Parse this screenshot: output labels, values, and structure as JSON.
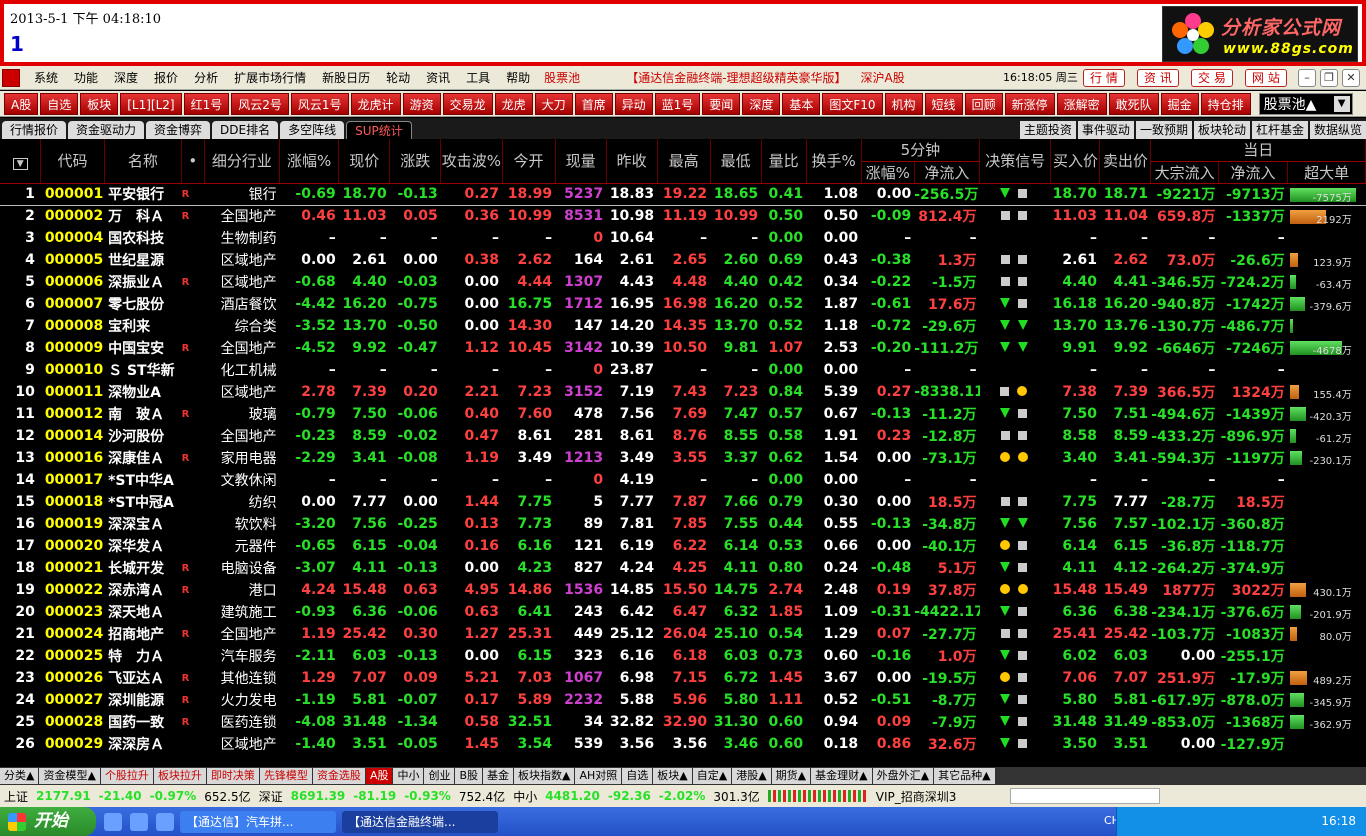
{
  "top": {
    "datetime": "2013-5-1 下午 04:18:10",
    "big_number": "1",
    "logo_line1": "分析家公式网",
    "logo_line2": "www.88gs.com"
  },
  "menu": {
    "items": [
      "系统",
      "功能",
      "深度",
      "报价",
      "分析",
      "扩展市场行情",
      "新股日历",
      "轮动",
      "资讯",
      "工具",
      "帮助"
    ],
    "pool": "股票池",
    "title": "【通达信金融终端-理想超级精英豪华版】",
    "market": "深沪A股",
    "clock": "16:18:05 周三",
    "quick": [
      "行 情",
      "资 讯",
      "交 易",
      "网 站"
    ]
  },
  "toolbar": {
    "buttons": [
      "A股",
      "自选",
      "板块",
      "[L1][L2]",
      "红1号",
      "风云2号",
      "风云1号",
      "龙虎计",
      "游资",
      "交易龙",
      "龙虎",
      "大刀",
      "首席",
      "异动",
      "蓝1号",
      "要闻",
      "深度",
      "基本",
      "图文F10",
      "机构",
      "短线",
      "回顾",
      "新涨停",
      "涨解密",
      "敢死队",
      "掘金",
      "持仓排"
    ],
    "select": "股票池▲"
  },
  "tabs": {
    "left": [
      "行情报价",
      "资金驱动力",
      "资金博弈",
      "DDE排名",
      "多空阵线",
      "SUP统计"
    ],
    "active": 5,
    "right": [
      "主题投资",
      "事件驱动",
      "一致预期",
      "板块轮动",
      "杠杆基金",
      "数据纵览"
    ]
  },
  "headers": {
    "five_min": "5分钟",
    "day": "当日",
    "cols": [
      "代码",
      "名称",
      "•",
      "细分行业",
      "涨幅%",
      "现价",
      "涨跌",
      "攻击波%",
      "今开",
      "现量",
      "昨收",
      "最高",
      "最低",
      "量比",
      "换手%",
      "涨幅%",
      "净流入",
      "决策信号",
      "买入价",
      "卖出价",
      "大宗流入",
      "净流入",
      "超大单"
    ]
  },
  "rows": [
    {
      "i": "1",
      "code": "000001",
      "name": "平安银行",
      "r": "R",
      "ind": "银行",
      "chg": "-0.69",
      "price": "18.70",
      "d": "-0.13",
      "atk": "0.27",
      "open": "18.99",
      "vol": "5237",
      "prev": "18.83",
      "hi": "19.22",
      "lo": "18.65",
      "lb": "0.41",
      "turn": "1.08",
      "m5": "0.00",
      "m5n": "-256.5万",
      "sig": [
        "tri",
        "sq"
      ],
      "buy": "18.70",
      "sell": "18.71",
      "big": "-9221万",
      "net": "-9713万",
      "sup": "-7575万",
      "supv": -7575
    },
    {
      "i": "2",
      "code": "000002",
      "name": "万　科Ａ",
      "r": "R",
      "ind": "全国地产",
      "chg": "0.46",
      "price": "11.03",
      "d": "0.05",
      "atk": "0.36",
      "open": "10.99",
      "vol": "8531",
      "prev": "10.98",
      "hi": "11.19",
      "lo": "10.99",
      "lb": "0.50",
      "turn": "0.50",
      "m5": "-0.09",
      "m5n": "812.4万",
      "sig": [
        "sq",
        "sq"
      ],
      "buy": "11.03",
      "sell": "11.04",
      "big": "659.8万",
      "net": "-1337万",
      "sup": "2192万",
      "supv": 2192
    },
    {
      "i": "3",
      "code": "000004",
      "name": "国农科技",
      "r": "",
      "ind": "生物制药",
      "chg": "–",
      "price": "–",
      "d": "–",
      "atk": "–",
      "open": "–",
      "vol": "0",
      "prev": "10.64",
      "hi": "–",
      "lo": "–",
      "lb": "0.00",
      "turn": "0.00",
      "m5": "–",
      "m5n": "–",
      "sig": [],
      "buy": "–",
      "sell": "–",
      "big": "–",
      "net": "–",
      "sup": "",
      "supv": 0
    },
    {
      "i": "4",
      "code": "000005",
      "name": "世纪星源",
      "r": "",
      "ind": "区域地产",
      "chg": "0.00",
      "price": "2.61",
      "d": "0.00",
      "atk": "0.38",
      "open": "2.62",
      "vol": "164",
      "prev": "2.61",
      "hi": "2.65",
      "lo": "2.60",
      "lb": "0.69",
      "turn": "0.43",
      "m5": "-0.38",
      "m5n": "1.3万",
      "sig": [
        "sq",
        "sq"
      ],
      "buy": "2.61",
      "sell": "2.62",
      "big": "73.0万",
      "net": "-26.6万",
      "sup": "123.9万",
      "supv": 124
    },
    {
      "i": "5",
      "code": "000006",
      "name": "深振业Ａ",
      "r": "R",
      "ind": "区域地产",
      "chg": "-0.68",
      "price": "4.40",
      "d": "-0.03",
      "atk": "0.00",
      "open": "4.44",
      "vol": "1307",
      "prev": "4.43",
      "hi": "4.48",
      "lo": "4.40",
      "lb": "0.42",
      "turn": "0.34",
      "m5": "-0.22",
      "m5n": "-1.5万",
      "sig": [
        "sq",
        "sq"
      ],
      "buy": "4.40",
      "sell": "4.41",
      "big": "-346.5万",
      "net": "-724.2万",
      "sup": "-63.4万",
      "supv": -63
    },
    {
      "i": "6",
      "code": "000007",
      "name": "零七股份",
      "r": "",
      "ind": "酒店餐饮",
      "chg": "-4.42",
      "price": "16.20",
      "d": "-0.75",
      "atk": "0.00",
      "open": "16.75",
      "vol": "1712",
      "prev": "16.95",
      "hi": "16.98",
      "lo": "16.20",
      "lb": "0.52",
      "turn": "1.87",
      "m5": "-0.61",
      "m5n": "17.6万",
      "sig": [
        "tri",
        "sq"
      ],
      "buy": "16.18",
      "sell": "16.20",
      "big": "-940.8万",
      "net": "-1742万",
      "sup": "-379.6万",
      "supv": -380
    },
    {
      "i": "7",
      "code": "000008",
      "name": "宝利来",
      "r": "",
      "ind": "综合类",
      "chg": "-3.52",
      "price": "13.70",
      "d": "-0.50",
      "atk": "0.00",
      "open": "14.30",
      "vol": "147",
      "prev": "14.20",
      "hi": "14.35",
      "lo": "13.70",
      "lb": "0.52",
      "turn": "1.18",
      "m5": "-0.72",
      "m5n": "-29.6万",
      "sig": [
        "tri",
        "tri"
      ],
      "buy": "13.70",
      "sell": "13.76",
      "big": "-130.7万",
      "net": "-486.7万",
      "sup": "",
      "supv": -2
    },
    {
      "i": "8",
      "code": "000009",
      "name": "中国宝安",
      "r": "R",
      "ind": "全国地产",
      "chg": "-4.52",
      "price": "9.92",
      "d": "-0.47",
      "atk": "1.12",
      "open": "10.45",
      "vol": "3142",
      "prev": "10.39",
      "hi": "10.50",
      "lo": "9.81",
      "lb": "1.07",
      "turn": "2.53",
      "m5": "-0.20",
      "m5n": "-111.2万",
      "sig": [
        "tri",
        "tri"
      ],
      "buy": "9.91",
      "sell": "9.92",
      "big": "-6646万",
      "net": "-7246万",
      "sup": "-4678万",
      "supv": -4678
    },
    {
      "i": "9",
      "code": "000010",
      "name": "Ｓ ST华新",
      "r": "",
      "ind": "化工机械",
      "chg": "–",
      "price": "–",
      "d": "–",
      "atk": "–",
      "open": "–",
      "vol": "0",
      "prev": "23.87",
      "hi": "–",
      "lo": "–",
      "lb": "0.00",
      "turn": "0.00",
      "m5": "–",
      "m5n": "–",
      "sig": [],
      "buy": "–",
      "sell": "–",
      "big": "–",
      "net": "–",
      "sup": "",
      "supv": 0
    },
    {
      "i": "10",
      "code": "000011",
      "name": "深物业A",
      "r": "",
      "ind": "区域地产",
      "chg": "2.78",
      "price": "7.39",
      "d": "0.20",
      "atk": "2.21",
      "open": "7.23",
      "vol": "3152",
      "prev": "7.19",
      "hi": "7.43",
      "lo": "7.23",
      "lb": "0.84",
      "turn": "5.39",
      "m5": "0.27",
      "m5n": "-8338.11",
      "sig": [
        "sq",
        "dot"
      ],
      "buy": "7.38",
      "sell": "7.39",
      "big": "366.5万",
      "net": "1324万",
      "sup": "155.4万",
      "supv": 155
    },
    {
      "i": "11",
      "code": "000012",
      "name": "南　玻Ａ",
      "r": "R",
      "ind": "玻璃",
      "chg": "-0.79",
      "price": "7.50",
      "d": "-0.06",
      "atk": "0.40",
      "open": "7.60",
      "vol": "478",
      "prev": "7.56",
      "hi": "7.69",
      "lo": "7.47",
      "lb": "0.57",
      "turn": "0.67",
      "m5": "-0.13",
      "m5n": "-11.2万",
      "sig": [
        "tri",
        "sq"
      ],
      "buy": "7.50",
      "sell": "7.51",
      "big": "-494.6万",
      "net": "-1439万",
      "sup": "-420.3万",
      "supv": -420
    },
    {
      "i": "12",
      "code": "000014",
      "name": "沙河股份",
      "r": "",
      "ind": "全国地产",
      "chg": "-0.23",
      "price": "8.59",
      "d": "-0.02",
      "atk": "0.47",
      "open": "8.61",
      "vol": "281",
      "prev": "8.61",
      "hi": "8.76",
      "lo": "8.55",
      "lb": "0.58",
      "turn": "1.91",
      "m5": "0.23",
      "m5n": "-12.8万",
      "sig": [
        "sq",
        "sq"
      ],
      "buy": "8.58",
      "sell": "8.59",
      "big": "-433.2万",
      "net": "-896.9万",
      "sup": "-61.2万",
      "supv": -61
    },
    {
      "i": "13",
      "code": "000016",
      "name": "深康佳Ａ",
      "r": "R",
      "ind": "家用电器",
      "chg": "-2.29",
      "price": "3.41",
      "d": "-0.08",
      "atk": "1.19",
      "open": "3.49",
      "vol": "1213",
      "prev": "3.49",
      "hi": "3.55",
      "lo": "3.37",
      "lb": "0.62",
      "turn": "1.54",
      "m5": "0.00",
      "m5n": "-73.1万",
      "sig": [
        "dot",
        "dot"
      ],
      "buy": "3.40",
      "sell": "3.41",
      "big": "-594.3万",
      "net": "-1197万",
      "sup": "-230.1万",
      "supv": -230
    },
    {
      "i": "14",
      "code": "000017",
      "name": "*ST中华A",
      "r": "",
      "ind": "文教休闲",
      "chg": "–",
      "price": "–",
      "d": "–",
      "atk": "–",
      "open": "–",
      "vol": "0",
      "prev": "4.19",
      "hi": "–",
      "lo": "–",
      "lb": "0.00",
      "turn": "0.00",
      "m5": "–",
      "m5n": "–",
      "sig": [],
      "buy": "–",
      "sell": "–",
      "big": "–",
      "net": "–",
      "sup": "",
      "supv": 0
    },
    {
      "i": "15",
      "code": "000018",
      "name": "*ST中冠A",
      "r": "",
      "ind": "纺织",
      "chg": "0.00",
      "price": "7.77",
      "d": "0.00",
      "atk": "1.44",
      "open": "7.75",
      "vol": "5",
      "prev": "7.77",
      "hi": "7.87",
      "lo": "7.66",
      "lb": "0.79",
      "turn": "0.30",
      "m5": "0.00",
      "m5n": "18.5万",
      "sig": [
        "sq",
        "sq"
      ],
      "buy": "7.75",
      "sell": "7.77",
      "big": "-28.7万",
      "net": "18.5万",
      "sup": "",
      "supv": 0
    },
    {
      "i": "16",
      "code": "000019",
      "name": "深深宝Ａ",
      "r": "",
      "ind": "软饮料",
      "chg": "-3.20",
      "price": "7.56",
      "d": "-0.25",
      "atk": "0.13",
      "open": "7.73",
      "vol": "89",
      "prev": "7.81",
      "hi": "7.85",
      "lo": "7.55",
      "lb": "0.44",
      "turn": "0.55",
      "m5": "-0.13",
      "m5n": "-34.8万",
      "sig": [
        "tri",
        "tri"
      ],
      "buy": "7.56",
      "sell": "7.57",
      "big": "-102.1万",
      "net": "-360.8万",
      "sup": "",
      "supv": 0
    },
    {
      "i": "17",
      "code": "000020",
      "name": "深华发Ａ",
      "r": "",
      "ind": "元器件",
      "chg": "-0.65",
      "price": "6.15",
      "d": "-0.04",
      "atk": "0.16",
      "open": "6.16",
      "vol": "121",
      "prev": "6.19",
      "hi": "6.22",
      "lo": "6.14",
      "lb": "0.53",
      "turn": "0.66",
      "m5": "0.00",
      "m5n": "-40.1万",
      "sig": [
        "dot",
        "sq"
      ],
      "buy": "6.14",
      "sell": "6.15",
      "big": "-36.8万",
      "net": "-118.7万",
      "sup": "",
      "supv": 0
    },
    {
      "i": "18",
      "code": "000021",
      "name": "长城开发",
      "r": "R",
      "ind": "电脑设备",
      "chg": "-3.07",
      "price": "4.11",
      "d": "-0.13",
      "atk": "0.00",
      "open": "4.23",
      "vol": "827",
      "prev": "4.24",
      "hi": "4.25",
      "lo": "4.11",
      "lb": "0.80",
      "turn": "0.24",
      "m5": "-0.48",
      "m5n": "5.1万",
      "sig": [
        "tri",
        "sq"
      ],
      "buy": "4.11",
      "sell": "4.12",
      "big": "-264.2万",
      "net": "-374.9万",
      "sup": "",
      "supv": 0
    },
    {
      "i": "19",
      "code": "000022",
      "name": "深赤湾Ａ",
      "r": "R",
      "ind": "港口",
      "chg": "4.24",
      "price": "15.48",
      "d": "0.63",
      "atk": "4.95",
      "open": "14.86",
      "vol": "1536",
      "prev": "14.85",
      "hi": "15.50",
      "lo": "14.75",
      "lb": "2.74",
      "turn": "2.48",
      "m5": "0.19",
      "m5n": "37.8万",
      "sig": [
        "dot",
        "dot"
      ],
      "buy": "15.48",
      "sell": "15.49",
      "big": "1877万",
      "net": "3022万",
      "sup": "430.1万",
      "supv": 430
    },
    {
      "i": "20",
      "code": "000023",
      "name": "深天地Ａ",
      "r": "",
      "ind": "建筑施工",
      "chg": "-0.93",
      "price": "6.36",
      "d": "-0.06",
      "atk": "0.63",
      "open": "6.41",
      "vol": "243",
      "prev": "6.42",
      "hi": "6.47",
      "lo": "6.32",
      "lb": "1.85",
      "turn": "1.09",
      "m5": "-0.31",
      "m5n": "-4422.17",
      "sig": [
        "tri",
        "sq"
      ],
      "buy": "6.36",
      "sell": "6.38",
      "big": "-234.1万",
      "net": "-376.6万",
      "sup": "-201.9万",
      "supv": -202
    },
    {
      "i": "21",
      "code": "000024",
      "name": "招商地产",
      "r": "R",
      "ind": "全国地产",
      "chg": "1.19",
      "price": "25.42",
      "d": "0.30",
      "atk": "1.27",
      "open": "25.31",
      "vol": "449",
      "prev": "25.12",
      "hi": "26.04",
      "lo": "25.10",
      "lb": "0.54",
      "turn": "1.29",
      "m5": "0.07",
      "m5n": "-27.7万",
      "sig": [
        "sq",
        "sq"
      ],
      "buy": "25.41",
      "sell": "25.42",
      "big": "-103.7万",
      "net": "-1083万",
      "sup": "80.0万",
      "supv": 80
    },
    {
      "i": "22",
      "code": "000025",
      "name": "特　力Ａ",
      "r": "",
      "ind": "汽车服务",
      "chg": "-2.11",
      "price": "6.03",
      "d": "-0.13",
      "atk": "0.00",
      "open": "6.15",
      "vol": "323",
      "prev": "6.16",
      "hi": "6.18",
      "lo": "6.03",
      "lb": "0.73",
      "turn": "0.60",
      "m5": "-0.16",
      "m5n": "1.0万",
      "sig": [
        "tri",
        "sq"
      ],
      "buy": "6.02",
      "sell": "6.03",
      "big": "0.00",
      "net": "-255.1万",
      "sup": "",
      "supv": 0
    },
    {
      "i": "23",
      "code": "000026",
      "name": "飞亚达Ａ",
      "r": "R",
      "ind": "其他连锁",
      "chg": "1.29",
      "price": "7.07",
      "d": "0.09",
      "atk": "5.21",
      "open": "7.03",
      "vol": "1067",
      "prev": "6.98",
      "hi": "7.15",
      "lo": "6.72",
      "lb": "1.45",
      "turn": "3.67",
      "m5": "0.00",
      "m5n": "-19.5万",
      "sig": [
        "dot",
        "sq"
      ],
      "buy": "7.06",
      "sell": "7.07",
      "big": "251.9万",
      "net": "-17.9万",
      "sup": "489.2万",
      "supv": 489
    },
    {
      "i": "24",
      "code": "000027",
      "name": "深圳能源",
      "r": "R",
      "ind": "火力发电",
      "chg": "-1.19",
      "price": "5.81",
      "d": "-0.07",
      "atk": "0.17",
      "open": "5.89",
      "vol": "2232",
      "prev": "5.88",
      "hi": "5.96",
      "lo": "5.80",
      "lb": "1.11",
      "turn": "0.52",
      "m5": "-0.51",
      "m5n": "-8.7万",
      "sig": [
        "tri",
        "sq"
      ],
      "buy": "5.80",
      "sell": "5.81",
      "big": "-617.9万",
      "net": "-878.0万",
      "sup": "-345.9万",
      "supv": -346
    },
    {
      "i": "25",
      "code": "000028",
      "name": "国药一致",
      "r": "R",
      "ind": "医药连锁",
      "chg": "-4.08",
      "price": "31.48",
      "d": "-1.34",
      "atk": "0.58",
      "open": "32.51",
      "vol": "34",
      "prev": "32.82",
      "hi": "32.90",
      "lo": "31.30",
      "lb": "0.60",
      "turn": "0.94",
      "m5": "0.09",
      "m5n": "-7.9万",
      "sig": [
        "tri",
        "sq"
      ],
      "buy": "31.48",
      "sell": "31.49",
      "big": "-853.0万",
      "net": "-1368万",
      "sup": "-362.9万",
      "supv": -363
    },
    {
      "i": "26",
      "code": "000029",
      "name": "深深房Ａ",
      "r": "",
      "ind": "区域地产",
      "chg": "-1.40",
      "price": "3.51",
      "d": "-0.05",
      "atk": "1.45",
      "open": "3.54",
      "vol": "539",
      "prev": "3.56",
      "hi": "3.56",
      "lo": "3.46",
      "lb": "0.60",
      "turn": "0.18",
      "m5": "0.86",
      "m5n": "32.6万",
      "sig": [
        "tri",
        "sq"
      ],
      "buy": "3.50",
      "sell": "3.51",
      "big": "0.00",
      "net": "-127.9万",
      "sup": "",
      "supv": 0
    }
  ],
  "bottom_tabs": [
    "分类▲",
    "资金模型▲",
    "个股拉升",
    "板块拉升",
    "即时决策",
    "先锋模型",
    "资金选股",
    "A股",
    "中小",
    "创业",
    "B股",
    "基金",
    "板块指数▲",
    "AH对照",
    "自选",
    "板块▲",
    "自定▲",
    "港股▲",
    "期货▲",
    "基金理财▲",
    "外盘外汇▲",
    "其它品种▲"
  ],
  "status": {
    "sh_label": "上证",
    "sh_index": "2177.91",
    "sh_chg": "-21.40",
    "sh_pct": "-0.97%",
    "sh_amt": "652.5亿",
    "sz_label": "深证",
    "sz_index": "8691.39",
    "sz_chg": "-81.19",
    "sz_pct": "-0.93%",
    "sz_amt": "752.4亿",
    "zx_label": "中小",
    "zx_index": "4481.20",
    "zx_chg": "-92.36",
    "zx_pct": "-2.02%",
    "zx_amt": "301.3亿",
    "vip": "VIP_招商深圳3"
  },
  "taskbar": {
    "start": "开始",
    "tasks": [
      "【通达信】汽车拼...",
      "【通达信金融终端..."
    ],
    "ime": "CH",
    "time": "16:18"
  }
}
